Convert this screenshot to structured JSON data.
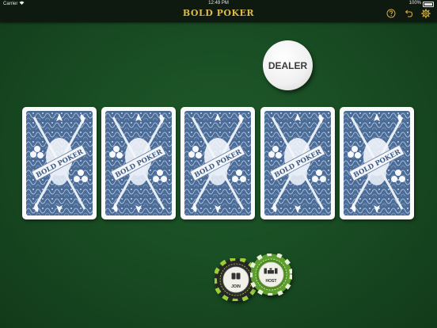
{
  "status_bar": {
    "carrier": "Carrier",
    "wifi_icon": "wifi-icon",
    "time": "12:49 PM",
    "battery": "100%"
  },
  "header": {
    "title": "BOLD POKER",
    "title_color": "#e0b949",
    "icons": [
      "help-icon",
      "undo-icon",
      "gear-icon"
    ]
  },
  "table": {
    "felt_color": "#1b4f25",
    "dealer_button": "DEALER",
    "cards": [
      {
        "face": "down",
        "back_text": "BOLD POKER"
      },
      {
        "face": "down",
        "back_text": "BOLD POKER"
      },
      {
        "face": "down",
        "back_text": "BOLD POKER"
      },
      {
        "face": "down",
        "back_text": "BOLD POKER"
      },
      {
        "face": "down",
        "back_text": "BOLD POKER"
      }
    ],
    "card_back_color": "#4f6f9a"
  },
  "chips": {
    "join": {
      "label": "JOIN",
      "color": "#2a2a2a",
      "accent": "#9ccc3a"
    },
    "host": {
      "label": "HOST",
      "color": "#5a9a2a",
      "accent": "#ffffff"
    }
  }
}
